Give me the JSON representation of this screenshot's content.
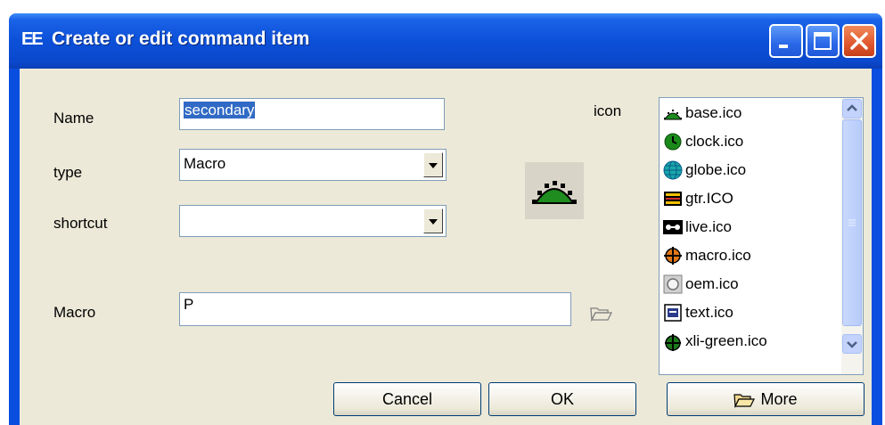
{
  "window": {
    "title": "Create or edit command item",
    "title_icon": "ΕΕ",
    "buttons": [
      "minimize",
      "maximize",
      "close"
    ]
  },
  "form": {
    "name_label": "Name",
    "name_value": "secondary",
    "type_label": "type",
    "type_value": "Macro",
    "shortcut_label": "shortcut",
    "shortcut_value": "",
    "macro_label": "Macro",
    "macro_value": "P",
    "icon_label": "icon"
  },
  "icon_list": {
    "items": [
      {
        "label": "base.ico",
        "icon": "base-icon"
      },
      {
        "label": "clock.ico",
        "icon": "clock-icon"
      },
      {
        "label": "globe.ico",
        "icon": "globe-icon"
      },
      {
        "label": "gtr.ICO",
        "icon": "gtr-icon"
      },
      {
        "label": "live.ico",
        "icon": "live-icon"
      },
      {
        "label": "macro.ico",
        "icon": "macro-icon"
      },
      {
        "label": "oem.ico",
        "icon": "oem-icon"
      },
      {
        "label": "text.ico",
        "icon": "text-icon"
      },
      {
        "label": "xli-green.ico",
        "icon": "xli-green-icon"
      }
    ]
  },
  "buttons": {
    "cancel": "Cancel",
    "ok": "OK",
    "more": "More"
  },
  "colors": {
    "titlebar": "#0a50d8",
    "dialog_bg": "#ece9d8",
    "selection": "#316ac5",
    "icon_green": "#1a8a1a"
  }
}
